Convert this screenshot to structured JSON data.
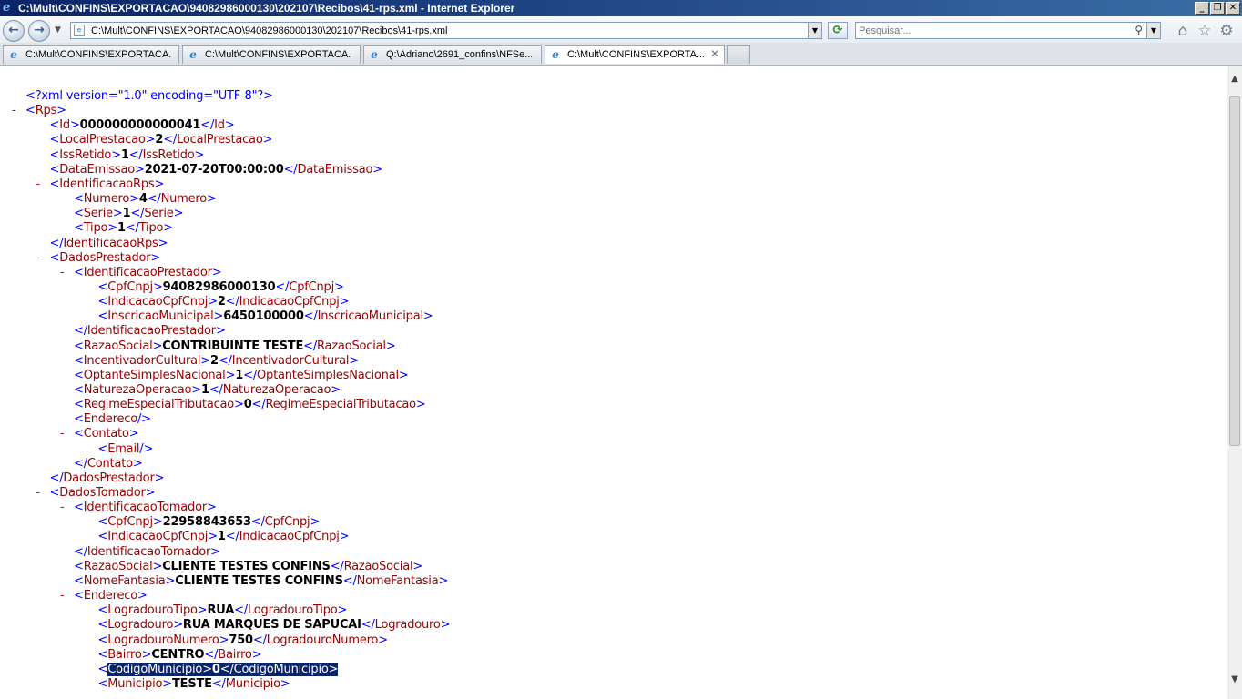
{
  "window": {
    "title": "C:\\Mult\\CONFINS\\EXPORTACAO\\94082986000130\\202107\\Recibos\\41-rps.xml - Internet Explorer",
    "controls": {
      "minimize": "_",
      "restore": "❐",
      "close": "✕"
    }
  },
  "toolbar": {
    "back_glyph": "←",
    "forward_glyph": "→",
    "address": "C:\\Mult\\CONFINS\\EXPORTACAO\\94082986000130\\202107\\Recibos\\41-rps.xml",
    "search_placeholder": "Pesquisar...",
    "icons": [
      "home-icon",
      "favorites-star-icon",
      "tools-gear-icon"
    ]
  },
  "tabs": [
    {
      "label": "C:\\Mult\\CONFINS\\EXPORTACA...",
      "active": false
    },
    {
      "label": "C:\\Mult\\CONFINS\\EXPORTACA...",
      "active": false
    },
    {
      "label": "Q:\\Adriano\\2691_confins\\NFSe...",
      "active": false
    },
    {
      "label": "C:\\Mult\\CONFINS\\EXPORTA...",
      "active": true
    }
  ],
  "xml_lines": [
    {
      "indent": 0,
      "pi": "<?xml version=\"1.0\" encoding=\"UTF-8\"?>"
    },
    {
      "indent": 0,
      "collapse": true,
      "open": "Rps"
    },
    {
      "indent": 1,
      "tag": "Id",
      "value": "000000000000041"
    },
    {
      "indent": 1,
      "tag": "LocalPrestacao",
      "value": "2"
    },
    {
      "indent": 1,
      "tag": "IssRetido",
      "value": "1"
    },
    {
      "indent": 1,
      "tag": "DataEmissao",
      "value": "2021-07-20T00:00:00"
    },
    {
      "indent": 1,
      "collapse": true,
      "open": "IdentificacaoRps"
    },
    {
      "indent": 2,
      "tag": "Numero",
      "value": "4"
    },
    {
      "indent": 2,
      "tag": "Serie",
      "value": "1"
    },
    {
      "indent": 2,
      "tag": "Tipo",
      "value": "1"
    },
    {
      "indent": 1,
      "close": "IdentificacaoRps"
    },
    {
      "indent": 1,
      "collapse": true,
      "open": "DadosPrestador"
    },
    {
      "indent": 2,
      "collapse": true,
      "open": "IdentificacaoPrestador"
    },
    {
      "indent": 3,
      "tag": "CpfCnpj",
      "value": "94082986000130"
    },
    {
      "indent": 3,
      "tag": "IndicacaoCpfCnpj",
      "value": "2"
    },
    {
      "indent": 3,
      "tag": "InscricaoMunicipal",
      "value": "6450100000"
    },
    {
      "indent": 2,
      "close": "IdentificacaoPrestador"
    },
    {
      "indent": 2,
      "tag": "RazaoSocial",
      "value": "CONTRIBUINTE TESTE"
    },
    {
      "indent": 2,
      "tag": "IncentivadorCultural",
      "value": "2"
    },
    {
      "indent": 2,
      "tag": "OptanteSimplesNacional",
      "value": "1"
    },
    {
      "indent": 2,
      "tag": "NaturezaOperacao",
      "value": "1"
    },
    {
      "indent": 2,
      "tag": "RegimeEspecialTributacao",
      "value": "0"
    },
    {
      "indent": 2,
      "empty": "Endereco"
    },
    {
      "indent": 2,
      "collapse": true,
      "open": "Contato"
    },
    {
      "indent": 3,
      "empty": "Email"
    },
    {
      "indent": 2,
      "close": "Contato"
    },
    {
      "indent": 1,
      "close": "DadosPrestador"
    },
    {
      "indent": 1,
      "collapse": true,
      "open": "DadosTomador"
    },
    {
      "indent": 2,
      "collapse": true,
      "open": "IdentificacaoTomador"
    },
    {
      "indent": 3,
      "tag": "CpfCnpj",
      "value": "22958843653"
    },
    {
      "indent": 3,
      "tag": "IndicacaoCpfCnpj",
      "value": "1"
    },
    {
      "indent": 2,
      "close": "IdentificacaoTomador"
    },
    {
      "indent": 2,
      "tag": "RazaoSocial",
      "value": "CLIENTE TESTES CONFINS"
    },
    {
      "indent": 2,
      "tag": "NomeFantasia",
      "value": "CLIENTE TESTES CONFINS"
    },
    {
      "indent": 2,
      "collapse": true,
      "open": "Endereco"
    },
    {
      "indent": 3,
      "tag": "LogradouroTipo",
      "value": "RUA"
    },
    {
      "indent": 3,
      "tag": "Logradouro",
      "value": "RUA MARQUES DE SAPUCAI"
    },
    {
      "indent": 3,
      "tag": "LogradouroNumero",
      "value": "750"
    },
    {
      "indent": 3,
      "tag": "Bairro",
      "value": "CENTRO"
    },
    {
      "indent": 3,
      "tag": "CodigoMunicipio",
      "value": "0",
      "selected": true
    },
    {
      "indent": 3,
      "tag": "Municipio",
      "value": "TESTE"
    }
  ],
  "scrollbar": {
    "up": "▲",
    "down": "▼",
    "position_fraction": 0.0
  },
  "colors": {
    "bracket": "#0000ff",
    "tag_name": "#990000",
    "value": "#000000",
    "collapse_minus": "#e00000",
    "selection": "#0a246a"
  }
}
